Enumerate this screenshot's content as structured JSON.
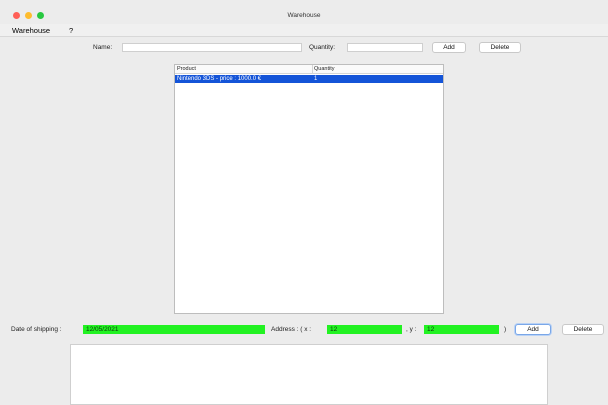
{
  "window": {
    "title": "Warehouse"
  },
  "menu": {
    "items": [
      "Warehouse",
      "?"
    ]
  },
  "product_form": {
    "name_label": "Name:",
    "name_value": "",
    "quantity_label": "Quantity:",
    "quantity_value": "",
    "add_label": "Add",
    "delete_label": "Delete"
  },
  "table": {
    "columns": [
      "Product",
      "Quantity"
    ],
    "rows": [
      {
        "product": "Nintendo 3DS - price : 1000.0 €",
        "quantity": "1"
      }
    ]
  },
  "shipping": {
    "date_label": "Date of shipping :",
    "date_value": "12/05/2021",
    "address_label": "Address : ( x :",
    "x_value": "12",
    "y_label": ", y :",
    "y_value": "12",
    "close_paren": ")",
    "add_label": "Add",
    "delete_label": "Delete"
  },
  "colors": {
    "valid_field": "#22f222",
    "selection": "#1454d8"
  }
}
